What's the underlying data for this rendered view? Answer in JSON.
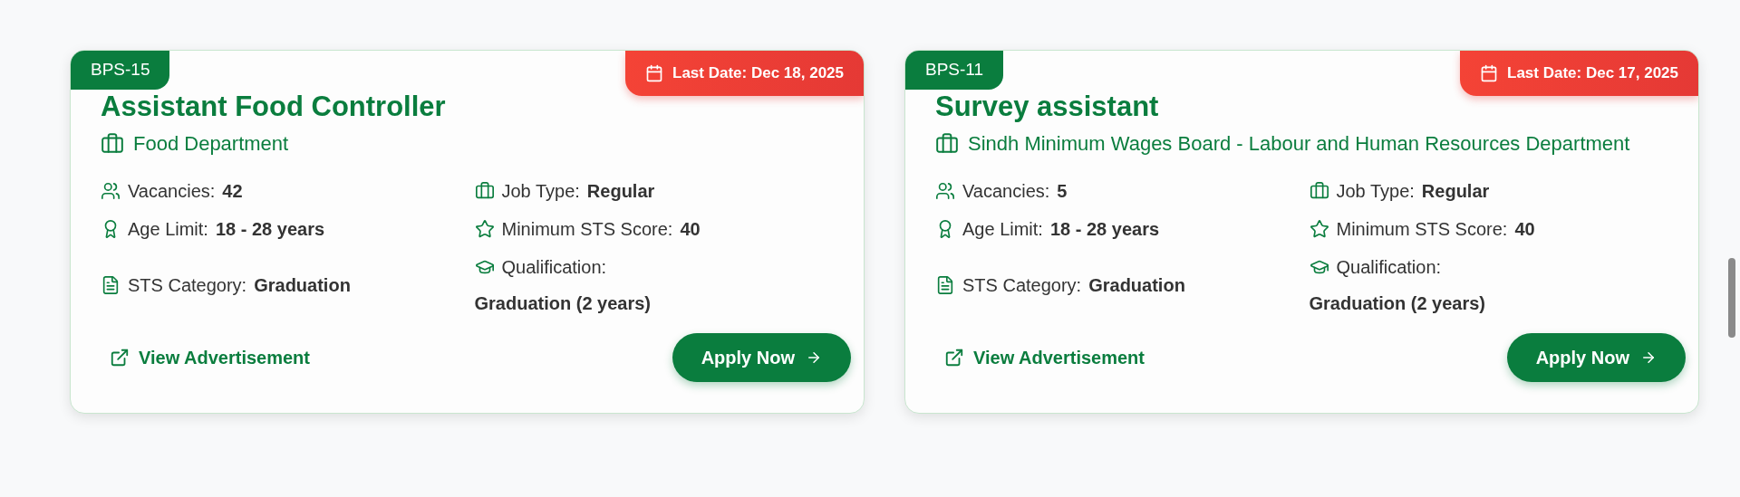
{
  "jobs": [
    {
      "grade": "BPS-15",
      "last_date": "Last Date: Dec 18, 2025",
      "title": "Assistant Food Controller",
      "department": "Food Department",
      "details": [
        {
          "kind": "vacancies",
          "label": "Vacancies:",
          "value": "42"
        },
        {
          "kind": "job_type",
          "label": "Job Type:",
          "value": "Regular"
        },
        {
          "kind": "age_limit",
          "label": "Age Limit:",
          "value": "18 - 28 years"
        },
        {
          "kind": "min_score",
          "label": "Minimum STS Score:",
          "value": "40"
        },
        {
          "kind": "sts_category",
          "label": "STS Category:",
          "value": "Graduation"
        },
        {
          "kind": "qualification",
          "label": "Qualification:",
          "value": "Graduation (2 years)"
        }
      ],
      "link": "View Advertisement",
      "button": "Apply Now"
    },
    {
      "grade": "BPS-11",
      "last_date": "Last Date: Dec 17, 2025",
      "title": "Survey assistant",
      "department": "Sindh Minimum Wages Board - Labour and Human Resources Department",
      "details": [
        {
          "kind": "vacancies",
          "label": "Vacancies:",
          "value": "5"
        },
        {
          "kind": "job_type",
          "label": "Job Type:",
          "value": "Regular"
        },
        {
          "kind": "age_limit",
          "label": "Age Limit:",
          "value": "18 - 28 years"
        },
        {
          "kind": "min_score",
          "label": "Minimum STS Score:",
          "value": "40"
        },
        {
          "kind": "sts_category",
          "label": "STS Category:",
          "value": "Graduation"
        },
        {
          "kind": "qualification",
          "label": "Qualification:",
          "value": "Graduation (2 years)"
        }
      ],
      "link": "View Advertisement",
      "button": "Apply Now"
    }
  ]
}
